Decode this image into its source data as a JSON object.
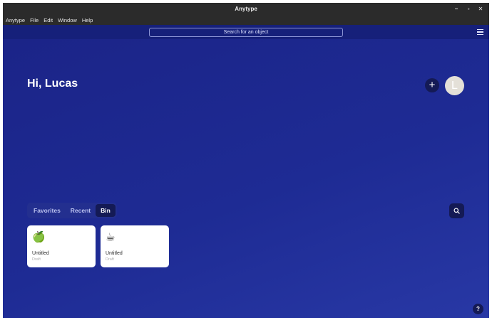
{
  "window": {
    "title": "Anytype",
    "controls": {
      "minimize": "−",
      "maximize": "▫",
      "close": "✕"
    }
  },
  "menubar": {
    "items": [
      "Anytype",
      "File",
      "Edit",
      "Window",
      "Help"
    ]
  },
  "topbar": {
    "search_placeholder": "Search for an object",
    "menu_icon": "hamburger-icon"
  },
  "home": {
    "greeting": "Hi, Lucas",
    "add_label": "+",
    "avatar_initial": "L"
  },
  "tabs": [
    {
      "label": "Favorites",
      "active": false
    },
    {
      "label": "Recent",
      "active": false
    },
    {
      "label": "Bin",
      "active": true
    }
  ],
  "cards": [
    {
      "emoji": "🍏",
      "icon": "green-apple-icon",
      "title": "Untitled",
      "type": "Draft"
    },
    {
      "emoji": "☕",
      "icon": "coffee-icon",
      "title": "Untitled",
      "type": "Draft"
    }
  ],
  "help_label": "?",
  "colors": {
    "background": "#1c2a8c",
    "accent_dark": "#141a55",
    "card": "#ffffff"
  }
}
